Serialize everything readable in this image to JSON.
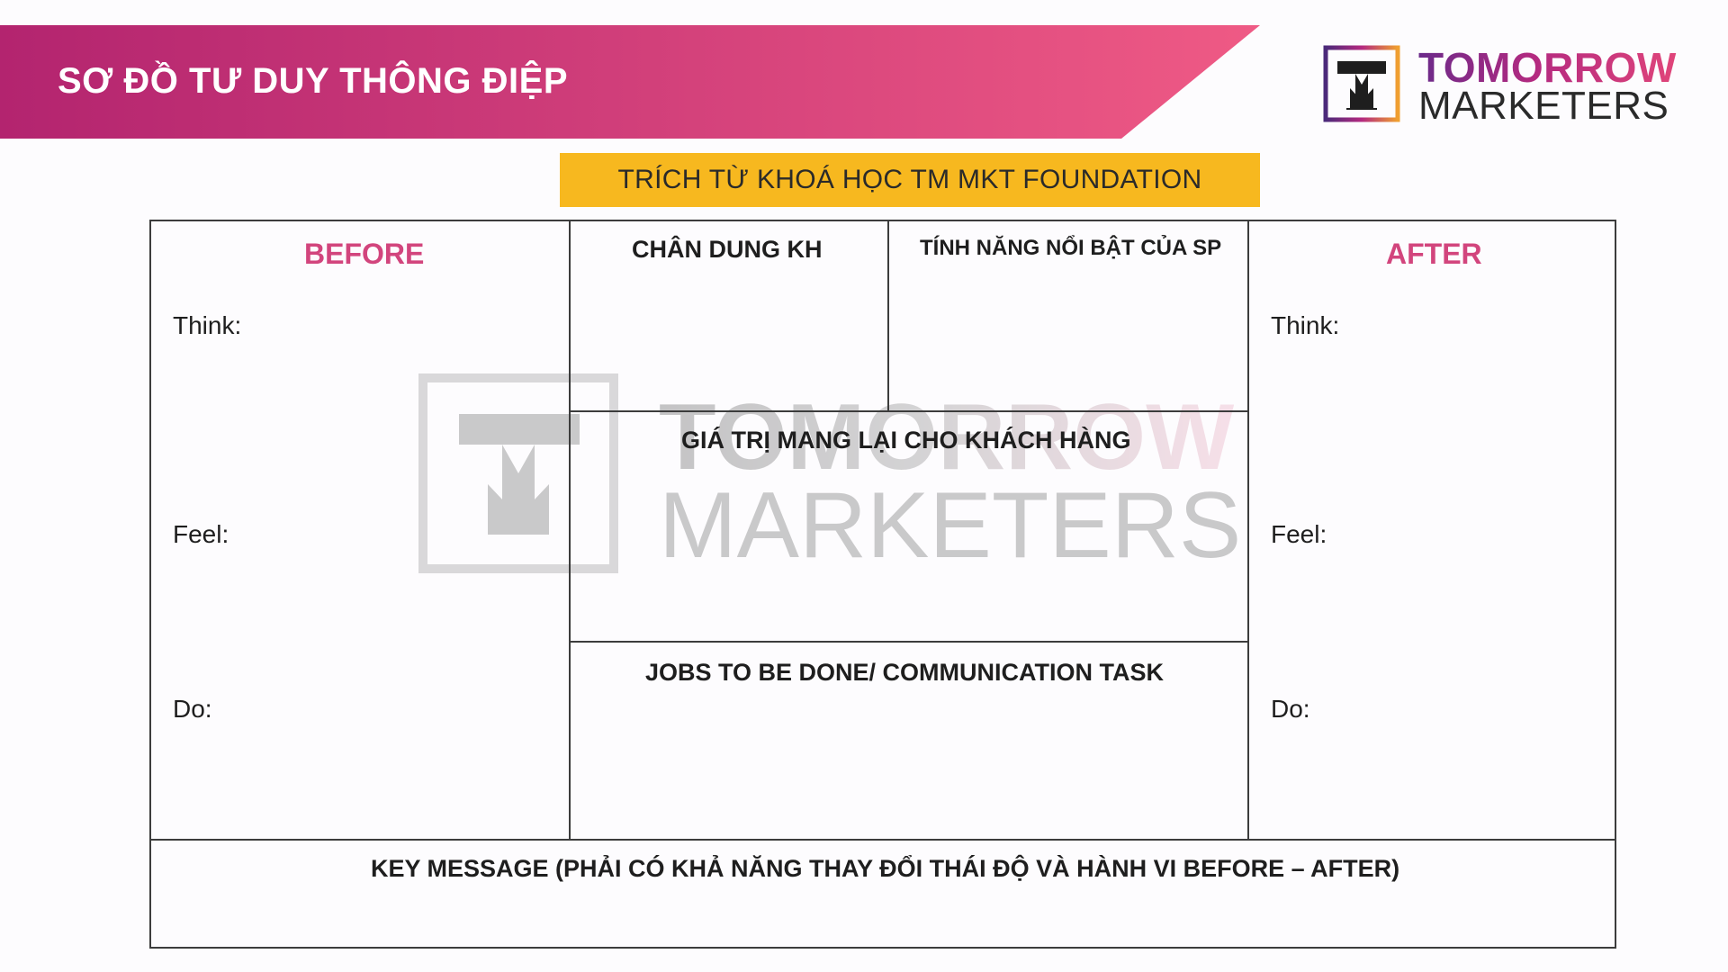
{
  "header": {
    "title": "SƠ ĐỒ TƯ DUY THÔNG ĐIỆP",
    "banner_color_start": "#b3246f",
    "banner_color_end": "#ef5a85"
  },
  "logo": {
    "line1": "TOMORROW",
    "line2": "MARKETERS",
    "icon": "tm-logo-icon"
  },
  "subtitle": {
    "text": "TRÍCH TỪ KHOÁ HỌC TM MKT FOUNDATION",
    "background": "#f7b81f"
  },
  "diagram": {
    "before": {
      "heading": "BEFORE",
      "think": "Think:",
      "feel": "Feel:",
      "do": "Do:"
    },
    "after": {
      "heading": "AFTER",
      "think": "Think:",
      "feel": "Feel:",
      "do": "Do:"
    },
    "customer_portrait": "CHÂN DUNG KH",
    "product_features": "TÍNH NĂNG NỔI BẬT CỦA SP",
    "customer_value": "GIÁ TRỊ MANG LẠI CHO KHÁCH HÀNG",
    "jobs_to_be_done": "JOBS TO BE DONE/ COMMUNICATION TASK",
    "key_message": "KEY MESSAGE (PHẢI CÓ KHẢ NĂNG THAY ĐỔI THÁI ĐỘ VÀ HÀNH VI BEFORE – AFTER)",
    "heading_color": "#d2457d"
  },
  "watermark": {
    "line1": "TOMORROW",
    "line2": "MARKETERS"
  }
}
